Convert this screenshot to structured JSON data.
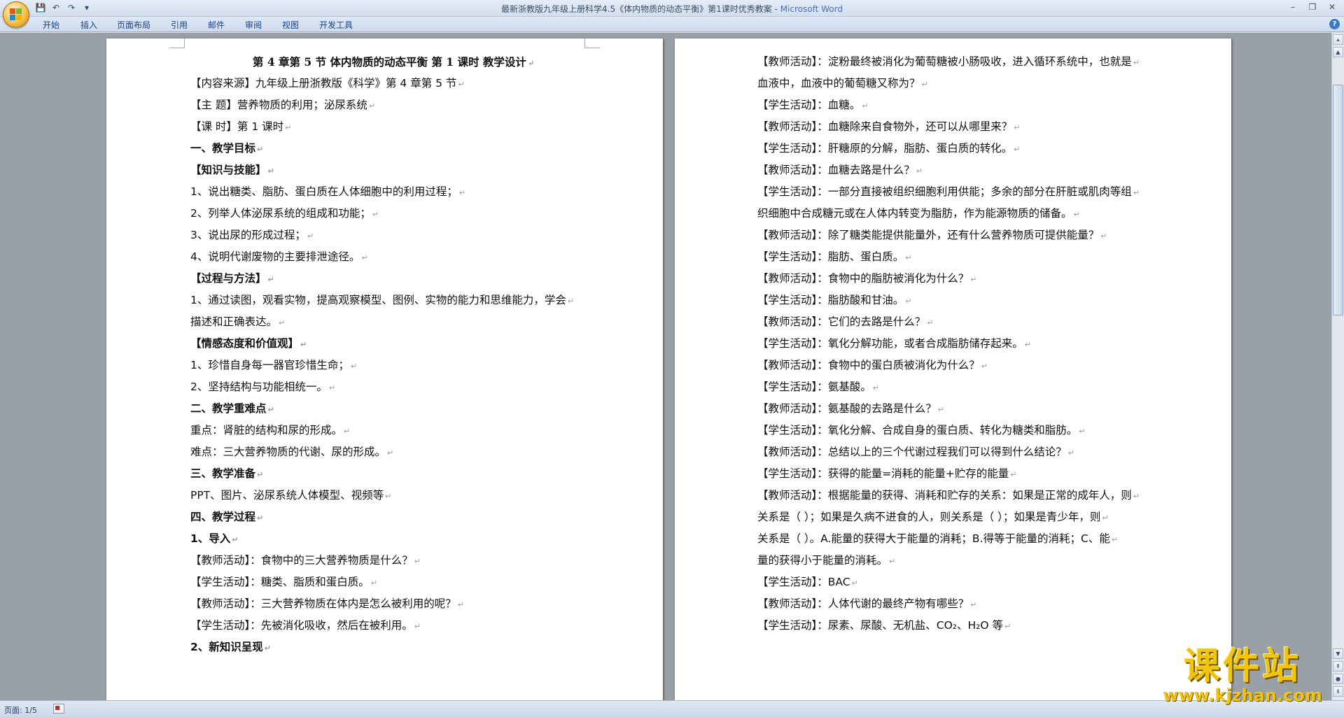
{
  "window": {
    "title_prefix": "最新浙教版九年级上册科学4.5《体内物质的动态平衡》第1课时优秀教案",
    "title_sep": " - ",
    "app_name": "Microsoft Word"
  },
  "qat": {
    "save": "💾",
    "undo": "↶",
    "redo": "↷",
    "more": "▾"
  },
  "window_controls": {
    "minimize": "–",
    "maximize": "❐",
    "close": "✕"
  },
  "ribbon_tabs": [
    "开始",
    "插入",
    "页面布局",
    "引用",
    "邮件",
    "审阅",
    "视图",
    "开发工具"
  ],
  "help": "?",
  "page1": {
    "title": "第 4 章第 5 节  体内物质的动态平衡  第 1 课时  教学设计",
    "lines": [
      "【内容来源】九年级上册浙教版《科学》第 4 章第 5 节",
      "【主        题】营养物质的利用；泌尿系统",
      "【课        时】第 1 课时",
      "一、教学目标",
      "【知识与技能】",
      "1、说出糖类、脂肪、蛋白质在人体细胞中的利用过程；",
      "2、列举人体泌尿系统的组成和功能；",
      "3、说出尿的形成过程；",
      "4、说明代谢废物的主要排泄途径。",
      "【过程与方法】",
      "1、通过读图，观看实物，提高观察模型、图例、实物的能力和思维能力，学会",
      "描述和正确表达。",
      "【情感态度和价值观】",
      "1、珍惜自身每一器官珍惜生命；",
      "2、坚持结构与功能相统一。",
      "二、教学重难点",
      "重点：肾脏的结构和尿的形成。",
      "难点：三大营养物质的代谢、尿的形成。",
      "三、教学准备",
      "PPT、图片、泌尿系统人体模型、视频等",
      "四、教学过程",
      "1、导入",
      "【教师活动】：食物中的三大营养物质是什么？",
      "【学生活动】：糖类、脂质和蛋白质。",
      "【教师活动】：三大营养物质在体内是怎么被利用的呢？",
      "【学生活动】：先被消化吸收，然后在被利用。",
      "2、新知识呈现"
    ]
  },
  "page2": {
    "lines": [
      "【教师活动】：淀粉最终被消化为葡萄糖被小肠吸收，进入循环系统中，也就是",
      "血液中，血液中的葡萄糖又称为？",
      "【学生活动】：血糖。",
      "【教师活动】：血糖除来自食物外，还可以从哪里来？",
      "【学生活动】：肝糖原的分解，脂肪、蛋白质的转化。",
      "【教师活动】：血糖去路是什么？",
      "【学生活动】：一部分直接被组织细胞利用供能；多余的部分在肝脏或肌肉等组",
      "织细胞中合成糖元或在人体内转变为脂肪，作为能源物质的储备。",
      "【教师活动】：除了糖类能提供能量外，还有什么营养物质可提供能量？",
      "【学生活动】：脂肪、蛋白质。",
      "【教师活动】：食物中的脂肪被消化为什么？",
      "【学生活动】：脂肪酸和甘油。",
      "【教师活动】：它们的去路是什么？",
      "【学生活动】：氧化分解功能，或者合成脂肪储存起来。",
      "【教师活动】：食物中的蛋白质被消化为什么？",
      "【学生活动】：氨基酸。",
      "【教师活动】：氨基酸的去路是什么？",
      "【学生活动】：氧化分解、合成自身的蛋白质、转化为糖类和脂肪。",
      "【教师活动】：总结以上的三个代谢过程我们可以得到什么结论？",
      "【学生活动】：获得的能量=消耗的能量+贮存的能量",
      "【教师活动】：根据能量的获得、消耗和贮存的关系：如果是正常的成年人，则",
      "关系是（      ）；如果是久病不进食的人，则关系是（      ）；如果是青少年，则",
      "关系是（      ）。A.能量的获得大于能量的消耗；B.得等于能量的消耗；C、能",
      "量的获得小于能量的消耗。",
      "【学生活动】：BAC",
      "【教师活动】：人体代谢的最终产物有哪些？",
      "【学生活动】：尿素、尿酸、无机盐、CO₂、H₂O 等"
    ]
  },
  "paragraph_mark": "↵",
  "status": {
    "page_info": "页面: 1/5"
  },
  "watermark": {
    "brand": "课件站",
    "url": "www.kjzhan.com"
  },
  "colors": {
    "accent": "#15428b",
    "app_name": "#4a6fb1",
    "watermark": "#f1c40f"
  }
}
